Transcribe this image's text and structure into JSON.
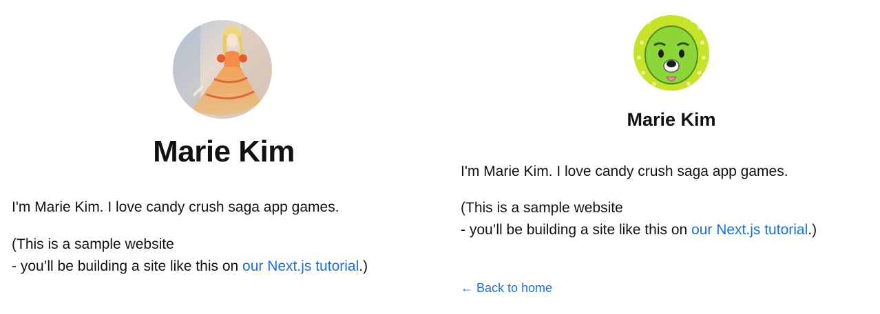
{
  "left_profile": {
    "avatar": "princess-illustration-avatar",
    "name": "Marie Kim",
    "intro": "I'm Marie Kim. I love candy crush saga app games.",
    "sample_line1": "(This is a sample website",
    "sample_line2_prefix": "- you’ll be building a site like this on ",
    "tutorial_link": "our Next.js tutorial",
    "sample_line2_suffix": ".)"
  },
  "right_profile": {
    "avatar": "green-cartoon-character-avatar",
    "name": "Marie Kim",
    "intro": "I'm Marie Kim. I love candy crush saga app games.",
    "sample_line1": "(This is a sample website",
    "sample_line2_prefix": "- you’ll be building a site like this on ",
    "tutorial_link": "our Next.js tutorial",
    "sample_line2_suffix": ".)",
    "back_link": "← Back to home"
  },
  "colors": {
    "link": "#1a6fd8",
    "text": "#111111",
    "avatar_green_bg": "#c6e22a",
    "character_green": "#8dd63a"
  }
}
